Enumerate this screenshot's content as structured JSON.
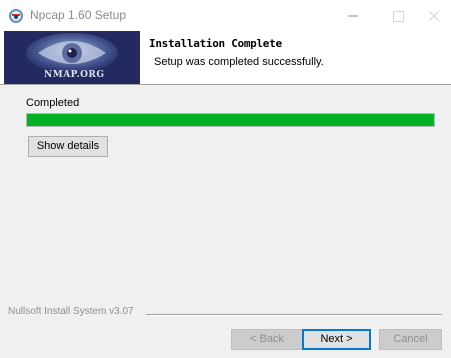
{
  "window": {
    "title": "Npcap 1.60 Setup",
    "icon": "npcap-app-icon"
  },
  "header": {
    "logo_text": "NMAP.ORG",
    "title": "Installation Complete",
    "subtitle": "Setup was completed successfully."
  },
  "main": {
    "status_label": "Completed",
    "progress_percent": 100,
    "progress_color": "#06b025",
    "show_details_label": "Show details"
  },
  "footer": {
    "branding": "Nullsoft Install System v3.07",
    "back_label": "< Back",
    "next_label": "Next >",
    "cancel_label": "Cancel"
  },
  "colors": {
    "focus_border": "#0078d7",
    "disabled_text": "#8f8f8f"
  }
}
